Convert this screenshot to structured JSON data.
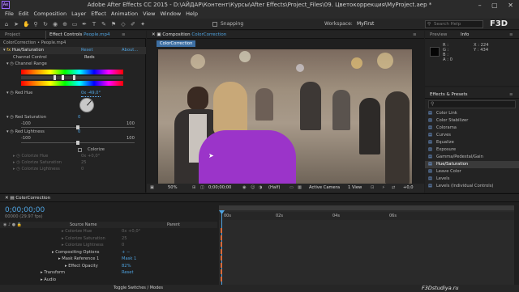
{
  "app": {
    "title": "Adobe After Effects CC 2015 - D:\\АЙДАР\\Контент\\Курсы\\After Effects\\Project_Files\\09. Цветокоррекция\\MyProject.aep *",
    "logo": "Ae",
    "window_controls": "–  ▢  ✕"
  },
  "menu": [
    "File",
    "Edit",
    "Composition",
    "Layer",
    "Effect",
    "Animation",
    "View",
    "Window",
    "Help"
  ],
  "toolbar": {
    "snapping_label": "Snapping",
    "workspace_label": "Workspace:",
    "workspace_value": "MyFirst",
    "search_placeholder": "Search Help"
  },
  "watermark_top": "F3D",
  "left_panel": {
    "tabs": [
      "Project",
      "Effect Controls",
      "People.mp4"
    ],
    "breadcrumb": "ColorCorrection • People.mp4",
    "effect_name": "Hue/Saturation",
    "reset_label": "Reset",
    "about_label": "About...",
    "channel_control_label": "Channel Control",
    "channel_control_value": "Reds",
    "channel_range_label": "Channel Range",
    "red_hue_label": "Red Hue",
    "red_hue_value": "0x -49,0°",
    "red_saturation_label": "Red Saturation",
    "red_saturation_value": "0",
    "red_lightness_label": "Red Lightness",
    "red_lightness_value": "0",
    "slider_min": "-100",
    "slider_max": "100",
    "colorize_label": "Colorize",
    "colorize_hue_label": "Colorize Hue",
    "colorize_hue_value": "0x +0,0°",
    "colorize_saturation_label": "Colorize Saturation",
    "colorize_saturation_value": "25",
    "colorize_lightness_label": "Colorize Lightness",
    "colorize_lightness_value": "0"
  },
  "comp_panel": {
    "tab_label": "Composition",
    "comp_name": "ColorCorrection",
    "sub_tab": "ColorCorrection",
    "footer": {
      "zoom": "50%",
      "timecode": "0;00;00;00",
      "resolution": "(Half)",
      "camera": "Active Camera",
      "views": "1 View",
      "offset": "+0,0"
    }
  },
  "info_panel": {
    "tabs": [
      "Preview",
      "Info"
    ],
    "r": "R :",
    "g": "G :",
    "b": "B :",
    "a": "A : 0",
    "x": "X : 224",
    "y": "Y : 434"
  },
  "effects_panel": {
    "title": "Effects & Presets",
    "items": [
      "Color Link",
      "Color Stabilizer",
      "Colorama",
      "Curves",
      "Equalize",
      "Exposure",
      "Gamma/Pedestal/Gain",
      "Hue/Saturation",
      "Leave Color",
      "Levels",
      "Levels (Individual Controls)"
    ],
    "selected_index": 7
  },
  "timeline": {
    "tab": "ColorCorrection",
    "timecode": "0;00;00;00",
    "fps": "00000 (29.97 fps)",
    "source_name_header": "Source Name",
    "parent_header": "Parent",
    "ruler_labels": [
      "00s",
      "02s",
      "04s",
      "06s"
    ],
    "rows": [
      {
        "label": "Colorize Hue",
        "value": "0x +0,0°",
        "dim": true
      },
      {
        "label": "Colorize Saturation",
        "value": "25",
        "dim": true
      },
      {
        "label": "Colorize Lightness",
        "value": "0",
        "dim": true
      },
      {
        "label": "Compositing Options",
        "value": "+ −",
        "dim": false
      },
      {
        "label": "Mask Reference 1",
        "value": "Mask 1",
        "dim": false
      },
      {
        "label": "Effect Opacity",
        "value": "82%",
        "dim": false
      },
      {
        "label": "Transform",
        "value": "Reset",
        "dim": false
      },
      {
        "label": "Audio",
        "value": "",
        "dim": false
      }
    ],
    "footer_label": "Toggle Switches / Modes"
  },
  "watermark_bottom": "F3Dstudiya.ru",
  "colors": {
    "accent": "#4fa3e0",
    "panel_bg": "#232323",
    "purple_shirt": "#9b34c9"
  }
}
